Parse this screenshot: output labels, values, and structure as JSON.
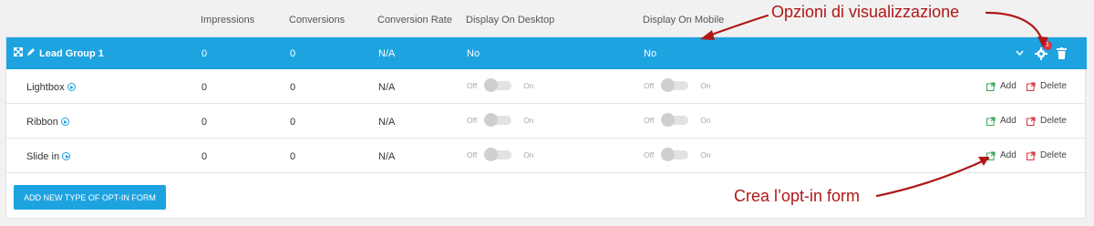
{
  "columns": [
    "Impressions",
    "Conversions",
    "Conversion Rate",
    "Display On Desktop",
    "Display On Mobile"
  ],
  "group": {
    "title": "Lead Group 1",
    "impressions": "0",
    "conversions": "0",
    "rate": "N/A",
    "desktop": "No",
    "mobile": "No",
    "badge": "1"
  },
  "rows": [
    {
      "label": "Lightbox",
      "impressions": "0",
      "conversions": "0",
      "rate": "N/A"
    },
    {
      "label": "Ribbon",
      "impressions": "0",
      "conversions": "0",
      "rate": "N/A"
    },
    {
      "label": "Slide in",
      "impressions": "0",
      "conversions": "0",
      "rate": "N/A"
    }
  ],
  "toggle": {
    "off": "Off",
    "on": "On"
  },
  "actions": {
    "add": "Add",
    "delete": "Delete"
  },
  "add_type_button": "ADD NEW TYPE OF OPT-IN FORM",
  "annotations": {
    "display_options": "Opzioni di visualizzazione",
    "create_form": "Crea l’opt-in form"
  },
  "colors": {
    "accent": "#1ea3e1",
    "annotation": "#b01717",
    "add_icon": "#3aa65a",
    "delete_icon": "#d9363e"
  }
}
